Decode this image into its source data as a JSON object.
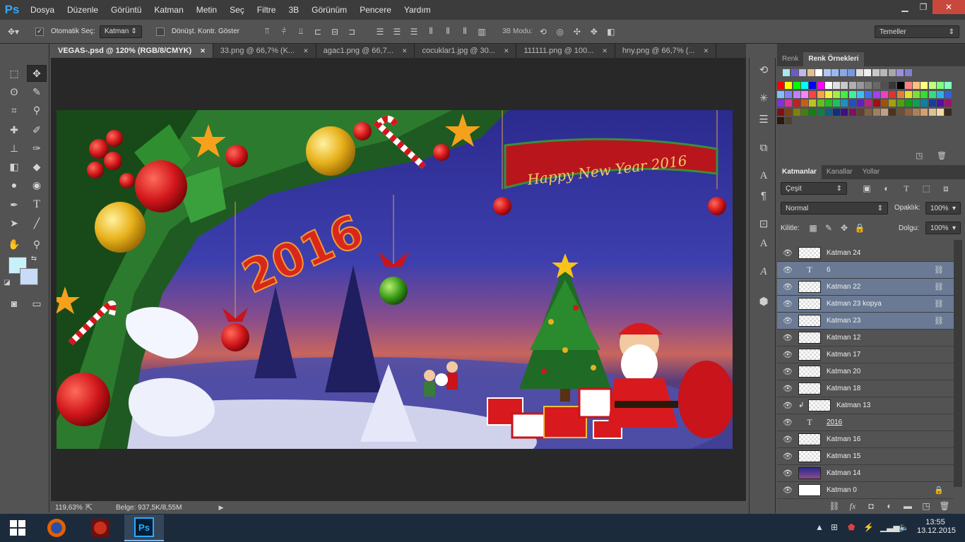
{
  "menu": {
    "logo": "Ps",
    "items": [
      "Dosya",
      "Düzenle",
      "Görüntü",
      "Katman",
      "Metin",
      "Seç",
      "Filtre",
      "3B",
      "Görünüm",
      "Pencere",
      "Yardım"
    ]
  },
  "window_controls": {
    "minimize": "▁",
    "restore": "❐",
    "close": "✕"
  },
  "options": {
    "auto_select": "Otomatik Seç:",
    "auto_select_target": "Katman",
    "show_transform": "Dönüşt. Kontr. Göster",
    "mode_3d": "3B Modu:",
    "workspace": "Temeller"
  },
  "tabs": [
    {
      "label": "VEGAS-.psd @ 120% (RGB/8/CMYK)",
      "active": true
    },
    {
      "label": "33.png @ 66,7% (K..."
    },
    {
      "label": "agac1.png @ 66,7..."
    },
    {
      "label": "cocuklar1.jpg @ 30..."
    },
    {
      "label": "111111.png @ 100..."
    },
    {
      "label": "hny.png @ 66,7% (..."
    }
  ],
  "tab_close": "✕",
  "canvas": {
    "banner_text": "Happy New Year 2016",
    "year_text": "2016"
  },
  "status": {
    "zoom": "119,63%",
    "doc": "Belge: 937,5K/8,55M"
  },
  "swatch_panel": {
    "tabs": [
      "Renk",
      "Renk Örnekleri"
    ]
  },
  "colors": {
    "accent_selected": "#6a7a94",
    "panel": "#535353",
    "dark": "#282828"
  },
  "layers_panel": {
    "tabs": [
      "Katmanlar",
      "Kanallar",
      "Yollar"
    ],
    "filter": "Çeşit",
    "blend_mode": "Normal",
    "opacity_label": "Opaklık:",
    "opacity": "100%",
    "lock_label": "Kilitle:",
    "fill_label": "Dolgu:",
    "fill": "100%",
    "layers": [
      {
        "name": "Katman 24",
        "kind": "pixel",
        "selected": false
      },
      {
        "name": "6",
        "kind": "text",
        "selected": true,
        "linked": true
      },
      {
        "name": "Katman 22",
        "kind": "pixel",
        "selected": true,
        "linked": true
      },
      {
        "name": "Katman 23 kopya",
        "kind": "pixel",
        "selected": true,
        "linked": true
      },
      {
        "name": "Katman 23",
        "kind": "pixel",
        "selected": true,
        "linked": true
      },
      {
        "name": "Katman 12",
        "kind": "pixel",
        "selected": false
      },
      {
        "name": "Katman 17",
        "kind": "pixel",
        "selected": false
      },
      {
        "name": "Katman 20",
        "kind": "pixel",
        "selected": false
      },
      {
        "name": "Katman 18",
        "kind": "pixel",
        "selected": false
      },
      {
        "name": "Katman 13",
        "kind": "pixel",
        "selected": false,
        "clipped": true
      },
      {
        "name": "2016",
        "kind": "text",
        "selected": false
      },
      {
        "name": "Katman 16",
        "kind": "pixel",
        "selected": false
      },
      {
        "name": "Katman 15",
        "kind": "pixel",
        "selected": false
      },
      {
        "name": "Katman 14",
        "kind": "image",
        "selected": false
      },
      {
        "name": "Katman 0",
        "kind": "white",
        "selected": false,
        "locked": true
      }
    ]
  },
  "taskbar": {
    "time": "13:55",
    "date": "13.12.2015"
  }
}
